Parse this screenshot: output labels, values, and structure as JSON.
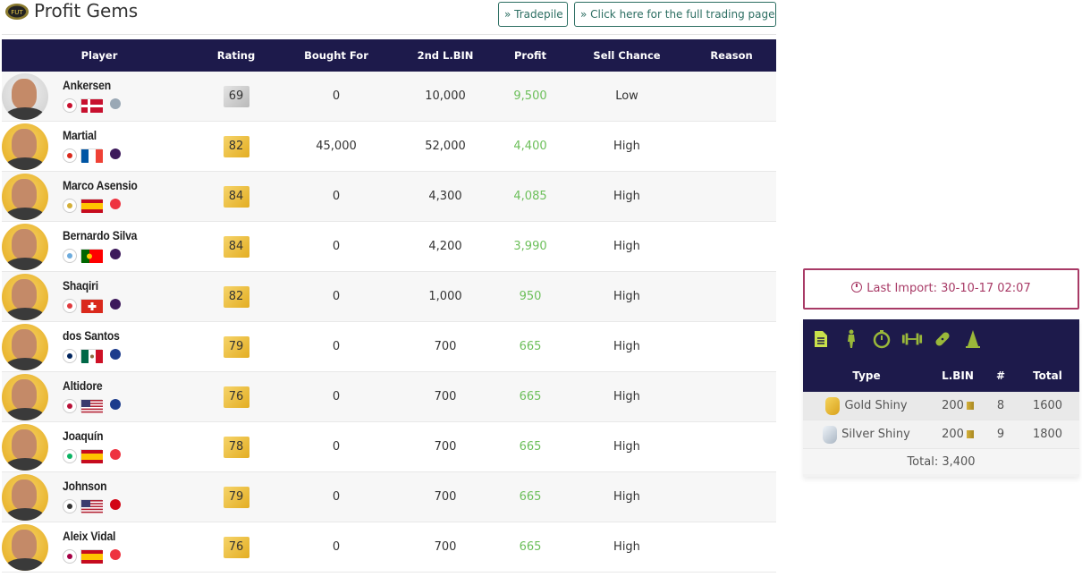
{
  "header": {
    "title": "Profit Gems",
    "tradepile_label": "» Tradepile",
    "trading_page_label": "» Click here for the full trading page"
  },
  "table": {
    "columns": [
      "Player",
      "Rating",
      "Bought For",
      "2nd L.BIN",
      "Profit",
      "Sell Chance",
      "Reason"
    ],
    "rows": [
      {
        "name": "Ankersen",
        "rating": "69",
        "bought": "0",
        "lbin": "10,000",
        "profit": "9,500",
        "chance": "Low",
        "reason": "",
        "tier": "silver",
        "club_color": "#c8102e",
        "flag": "denmark",
        "league_color": "#9aa8b5"
      },
      {
        "name": "Martial",
        "rating": "82",
        "bought": "45,000",
        "lbin": "52,000",
        "profit": "4,400",
        "chance": "High",
        "reason": "",
        "tier": "gold",
        "club_color": "#da291c",
        "flag": "france",
        "league_color": "#3d195b"
      },
      {
        "name": "Marco Asensio",
        "rating": "84",
        "bought": "0",
        "lbin": "4,300",
        "profit": "4,085",
        "chance": "High",
        "reason": "",
        "tier": "gold",
        "club_color": "#d4af37",
        "flag": "spain",
        "league_color": "#ee3340"
      },
      {
        "name": "Bernardo Silva",
        "rating": "84",
        "bought": "0",
        "lbin": "4,200",
        "profit": "3,990",
        "chance": "High",
        "reason": "",
        "tier": "gold",
        "club_color": "#6cabdd",
        "flag": "portugal",
        "league_color": "#3d195b"
      },
      {
        "name": "Shaqiri",
        "rating": "82",
        "bought": "0",
        "lbin": "1,000",
        "profit": "950",
        "chance": "High",
        "reason": "",
        "tier": "gold",
        "club_color": "#e03a3e",
        "flag": "switzerland",
        "league_color": "#3d195b"
      },
      {
        "name": "dos Santos",
        "rating": "79",
        "bought": "0",
        "lbin": "700",
        "profit": "665",
        "chance": "High",
        "reason": "",
        "tier": "gold",
        "club_color": "#00245d",
        "flag": "mexico",
        "league_color": "#1d3c8c"
      },
      {
        "name": "Altidore",
        "rating": "76",
        "bought": "0",
        "lbin": "700",
        "profit": "665",
        "chance": "High",
        "reason": "",
        "tier": "gold",
        "club_color": "#b81137",
        "flag": "usa",
        "league_color": "#1d3c8c"
      },
      {
        "name": "Joaquín",
        "rating": "78",
        "bought": "0",
        "lbin": "700",
        "profit": "665",
        "chance": "High",
        "reason": "",
        "tier": "gold",
        "club_color": "#0bb363",
        "flag": "spain",
        "league_color": "#ee3340"
      },
      {
        "name": "Johnson",
        "rating": "79",
        "bought": "0",
        "lbin": "700",
        "profit": "665",
        "chance": "High",
        "reason": "",
        "tier": "gold",
        "club_color": "#333333",
        "flag": "usa",
        "league_color": "#d20515"
      },
      {
        "name": "Aleix Vidal",
        "rating": "76",
        "bought": "0",
        "lbin": "700",
        "profit": "665",
        "chance": "High",
        "reason": "",
        "tier": "gold",
        "club_color": "#a50044",
        "flag": "spain",
        "league_color": "#ee3340"
      }
    ]
  },
  "import": {
    "label": "Last Import: 30-10-17 02:07"
  },
  "side": {
    "tab_icons": [
      "document-icon",
      "player-icon",
      "stopwatch-icon",
      "dumbbell-icon",
      "bandage-icon",
      "cone-icon"
    ],
    "columns": [
      "Type",
      "L.BIN",
      "#",
      "Total"
    ],
    "rows": [
      {
        "type": "Gold Shiny",
        "lbin": "200",
        "count": "8",
        "total": "1600",
        "tier": "gold"
      },
      {
        "type": "Silver Shiny",
        "lbin": "200",
        "count": "9",
        "total": "1800",
        "tier": "silver"
      }
    ],
    "total": "Total: 3,400"
  },
  "colors": {
    "header_navy": "#1d1a4b",
    "profit_green": "#6cbf5a",
    "import_accent": "#a83a66",
    "button_teal": "#2c6e62",
    "icon_green": "#9ab83a"
  }
}
